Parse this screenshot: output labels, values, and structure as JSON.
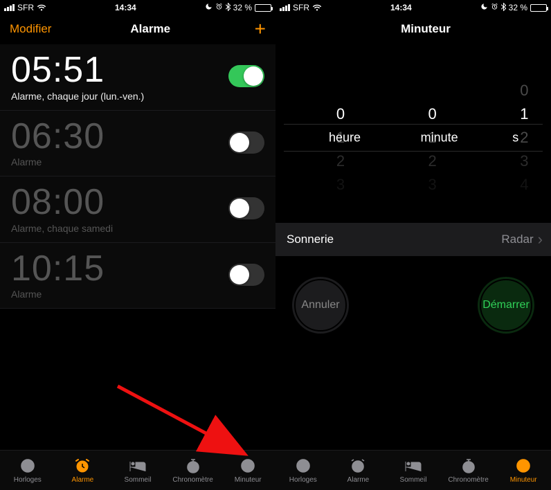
{
  "status": {
    "carrier": "SFR",
    "time": "14:34",
    "battery_pct": "32 %",
    "moon": "☾",
    "alarm": "⏰",
    "bt": "*"
  },
  "left": {
    "nav_left": "Modifier",
    "nav_title": "Alarme",
    "nav_right": "+",
    "alarms": [
      {
        "time": "05:51",
        "label": "Alarme, chaque jour (lun.-ven.)",
        "on": true
      },
      {
        "time": "06:30",
        "label": "Alarme",
        "on": false
      },
      {
        "time": "08:00",
        "label": "Alarme, chaque samedi",
        "on": false
      },
      {
        "time": "10:15",
        "label": "Alarme",
        "on": false
      }
    ]
  },
  "right": {
    "nav_title": "Minuteur",
    "picker": {
      "h": {
        "above": "",
        "sel": "0",
        "b1": "1",
        "b2": "2",
        "b3": "3",
        "unit": "heure"
      },
      "m": {
        "above": "",
        "sel": "0",
        "b1": "1",
        "b2": "2",
        "b3": "3",
        "unit": "minute"
      },
      "s": {
        "above": "0",
        "sel": "1",
        "b1": "2",
        "b2": "3",
        "b3": "4",
        "unit": "s"
      }
    },
    "sonnerie_label": "Sonnerie",
    "sonnerie_value": "Radar",
    "cancel": "Annuler",
    "start": "Démarrer"
  },
  "tabs": {
    "horloges": "Horloges",
    "alarme": "Alarme",
    "sommeil": "Sommeil",
    "chrono": "Chronomètre",
    "minuteur": "Minuteur"
  }
}
